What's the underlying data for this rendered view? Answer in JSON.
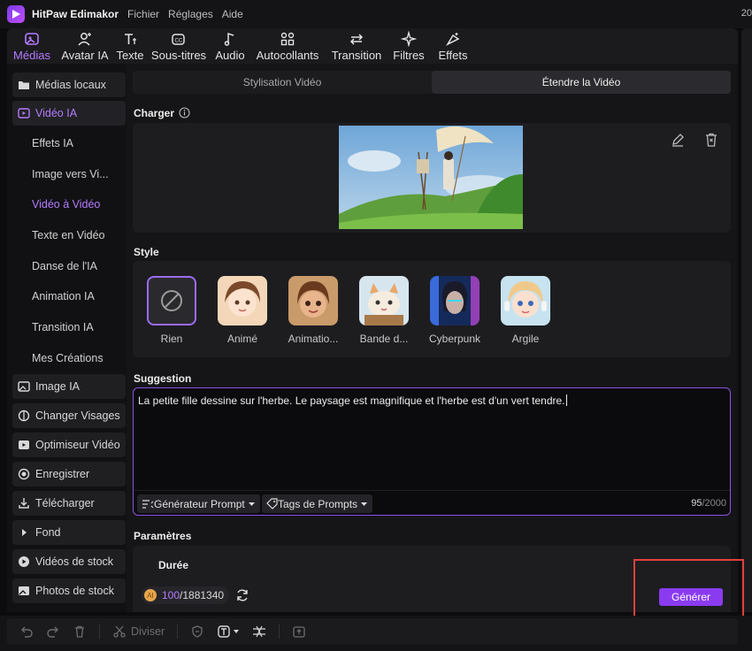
{
  "app": {
    "title": "HitPaw Edimakor",
    "title_right": "20"
  },
  "menu": [
    "Fichier",
    "Réglages",
    "Aide"
  ],
  "toolbar": {
    "items": [
      {
        "label": "Médias",
        "icon": "media-icon",
        "active": true
      },
      {
        "label": "Avatar IA",
        "icon": "avatar-icon"
      },
      {
        "label": "Texte",
        "icon": "text-icon"
      },
      {
        "label": "Sous-titres",
        "icon": "subtitles-icon"
      },
      {
        "label": "Audio",
        "icon": "audio-icon"
      },
      {
        "label": "Autocollants",
        "icon": "stickers-icon"
      },
      {
        "label": "Transition",
        "icon": "transition-icon"
      },
      {
        "label": "Filtres",
        "icon": "filters-icon"
      },
      {
        "label": "Effets",
        "icon": "effects-icon"
      }
    ]
  },
  "sidebar": {
    "medias_locaux": "Médias locaux",
    "video_ia": "Vidéo IA",
    "sub": [
      "Effets IA",
      "Image vers Vi...",
      "Vidéo à Vidéo",
      "Texte en Vidéo",
      "Danse de l'IA",
      "Animation IA",
      "Transition IA",
      "Mes Créations"
    ],
    "image_ia": "Image IA",
    "changer_visages": "Changer Visages",
    "optimiseur": "Optimiseur Vidéo",
    "enregistrer": "Enregistrer",
    "telecharger": "Télécharger",
    "fond": "Fond",
    "videos_stock": "Vidéos de stock",
    "photos_stock": "Photos de stock"
  },
  "tabs": {
    "stylisation": "Stylisation Vidéo",
    "etendre": "Étendre la Vidéo"
  },
  "charger": {
    "title": "Charger"
  },
  "style": {
    "title": "Style",
    "options": [
      "Rien",
      "Animé",
      "Animatio...",
      "Bande d...",
      "Cyberpunk",
      "Argile"
    ],
    "selected": "Rien"
  },
  "suggestion": {
    "title": "Suggestion",
    "text": "La petite fille dessine sur l'herbe. Le paysage est magnifique et l'herbe est d'un vert tendre.",
    "generator_btn": "Générateur Prompt",
    "tags_btn": "Tags de Prompts",
    "count": "95",
    "max": "/2000"
  },
  "parametres": {
    "title": "Paramètres",
    "duree": "Durée"
  },
  "credits": {
    "used": "100",
    "total": "/1881340"
  },
  "generate": {
    "label": "Générer"
  },
  "bottom": {
    "diviser": "Diviser"
  },
  "colors": {
    "accent": "#b57bff",
    "button": "#8a3bf0",
    "highlight": "#e0403a"
  }
}
